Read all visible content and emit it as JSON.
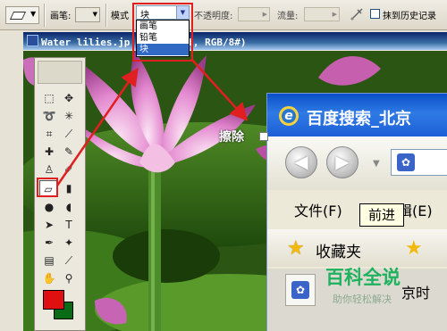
{
  "options_bar": {
    "brush_label": "画笔:",
    "mode_label": "模式",
    "mode_value": "块",
    "opacity_label": "不透明度:",
    "flow_label": "流量:",
    "erase_history_label": "抹到历史记录",
    "mode_options": [
      "画笔",
      "铅笔",
      "块"
    ]
  },
  "document": {
    "title_left": "Water lilies.jp",
    "title_right": "图层 1, RGB/8#)"
  },
  "callout": {
    "label": "擦除"
  },
  "colors": {
    "foreground": "#e01010",
    "background": "#0a6b17",
    "highlight": "#e02020"
  },
  "ie": {
    "title": "百度搜索_北京",
    "menu_file": "文件(F)",
    "menu_edit": "编辑(E)",
    "tooltip": "前进",
    "favorites": "收藏夹",
    "tab_text": "京时"
  },
  "watermark": {
    "title": "百科全说",
    "subtitle": "助你轻松解决"
  }
}
